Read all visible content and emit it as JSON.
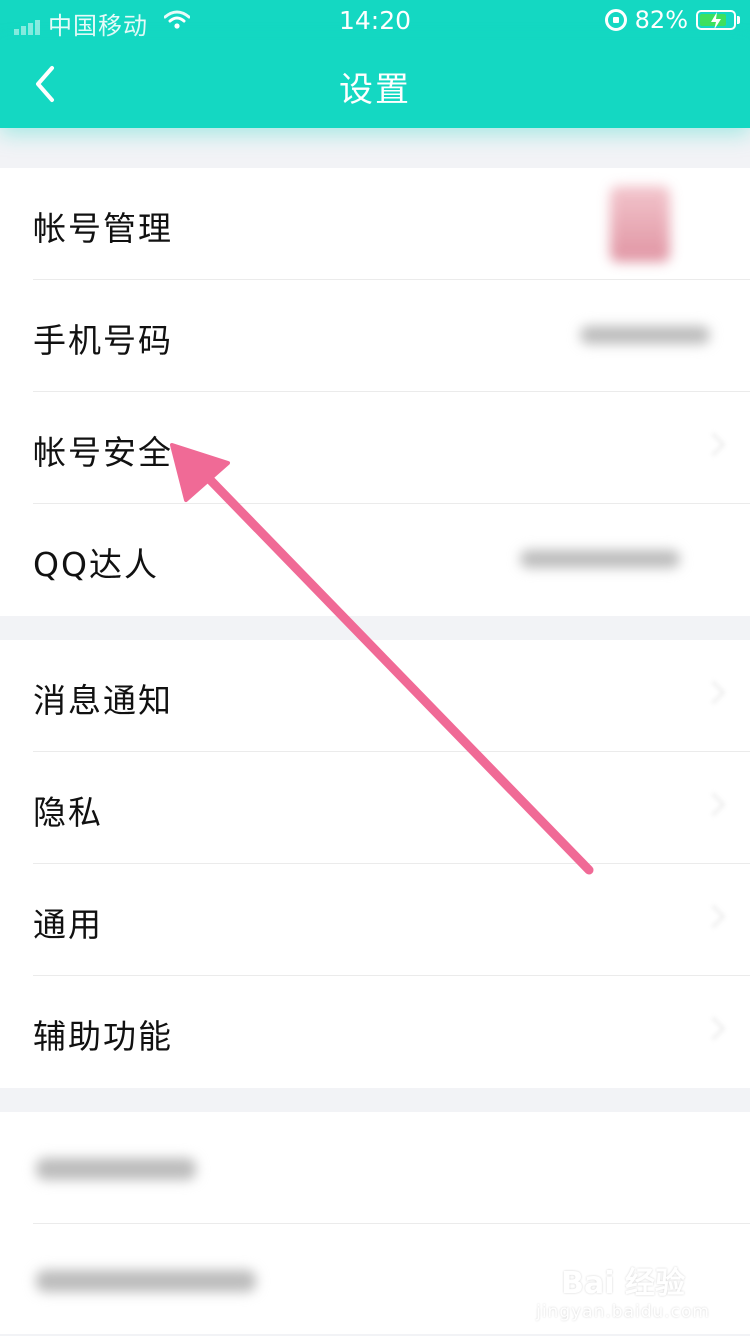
{
  "status_bar": {
    "carrier": "中国移动",
    "time": "14:20",
    "battery": "82%",
    "battery_level": 0.82
  },
  "nav": {
    "title": "设置"
  },
  "groups": [
    {
      "items": [
        {
          "label": "帐号管理"
        },
        {
          "label": "手机号码"
        },
        {
          "label": "帐号安全"
        },
        {
          "label": "QQ达人"
        }
      ]
    },
    {
      "items": [
        {
          "label": "消息通知"
        },
        {
          "label": "隐私"
        },
        {
          "label": "通用"
        },
        {
          "label": "辅助功能"
        }
      ]
    }
  ],
  "watermark": {
    "brand": "Bai 经验",
    "url": "jingyan.baidu.com"
  },
  "colors": {
    "accent": "#14d8c2",
    "annotation_arrow": "#f06a96"
  },
  "icons": {
    "back": "chevron-left-icon",
    "wifi": "wifi-icon",
    "rotation_lock": "rotation-lock-icon",
    "battery": "battery-charging-icon"
  }
}
